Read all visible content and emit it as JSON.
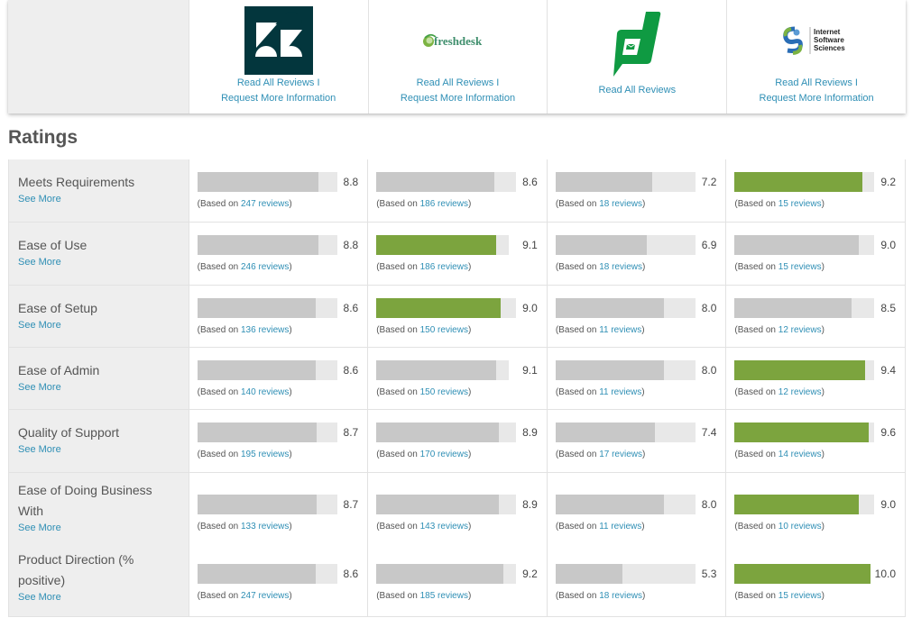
{
  "vendors": [
    {
      "name": "Zendesk",
      "logo_icon": "zendesk-logo",
      "read_all_reviews": "Read All Reviews",
      "separator": "I",
      "request_info": "Request More Information",
      "brand_color": "#03363d"
    },
    {
      "name": "Freshdesk",
      "logo_icon": "freshdesk-logo",
      "logo_text": "freshdesk",
      "read_all_reviews": "Read All Reviews",
      "separator": "I",
      "request_info": "Request More Information",
      "brand_color": "#2e8b57"
    },
    {
      "name": "Zoho Desk",
      "logo_icon": "zoho-desk-logo",
      "read_all_reviews": "Read All Reviews",
      "brand_color": "#0f9a42"
    },
    {
      "name": "Internet Software Sciences",
      "logo_icon": "internet-software-sciences-logo",
      "logo_text_lines": [
        "Internet",
        "Software",
        "Sciences"
      ],
      "read_all_reviews": "Read All Reviews",
      "separator": "I",
      "request_info": "Request More Information",
      "brand_color": "#2a6db5"
    }
  ],
  "ratings": {
    "title": "Ratings",
    "see_more_label": "See More",
    "based_on_prefix": "(Based on",
    "based_on_suffix": ")",
    "reviews_word": "reviews",
    "best_color": "#7ca43e",
    "bar_color": "#c8c8c8",
    "track_color": "#e8e8e8",
    "max_score": 10,
    "rows": [
      {
        "label": "Meets Requirements",
        "cells": [
          {
            "score": "8.8",
            "reviews": "247",
            "best": false
          },
          {
            "score": "8.6",
            "reviews": "186",
            "best": false
          },
          {
            "score": "7.2",
            "reviews": "18",
            "best": false
          },
          {
            "score": "9.2",
            "reviews": "15",
            "best": true
          }
        ]
      },
      {
        "label": "Ease of Use",
        "cells": [
          {
            "score": "8.8",
            "reviews": "246",
            "best": false
          },
          {
            "score": "9.1",
            "reviews": "186",
            "best": true
          },
          {
            "score": "6.9",
            "reviews": "18",
            "best": false
          },
          {
            "score": "9.0",
            "reviews": "15",
            "best": false
          }
        ]
      },
      {
        "label": "Ease of Setup",
        "cells": [
          {
            "score": "8.6",
            "reviews": "136",
            "best": false
          },
          {
            "score": "9.0",
            "reviews": "150",
            "best": true
          },
          {
            "score": "8.0",
            "reviews": "11",
            "best": false
          },
          {
            "score": "8.5",
            "reviews": "12",
            "best": false
          }
        ]
      },
      {
        "label": "Ease of Admin",
        "cells": [
          {
            "score": "8.6",
            "reviews": "140",
            "best": false
          },
          {
            "score": "9.1",
            "reviews": "150",
            "best": false
          },
          {
            "score": "8.0",
            "reviews": "11",
            "best": false
          },
          {
            "score": "9.4",
            "reviews": "12",
            "best": true
          }
        ]
      },
      {
        "label": "Quality of Support",
        "cells": [
          {
            "score": "8.7",
            "reviews": "195",
            "best": false
          },
          {
            "score": "8.9",
            "reviews": "170",
            "best": false
          },
          {
            "score": "7.4",
            "reviews": "17",
            "best": false
          },
          {
            "score": "9.6",
            "reviews": "14",
            "best": true
          }
        ]
      },
      {
        "label": "Ease of Doing Business With",
        "cells": [
          {
            "score": "8.7",
            "reviews": "133",
            "best": false
          },
          {
            "score": "8.9",
            "reviews": "143",
            "best": false
          },
          {
            "score": "8.0",
            "reviews": "11",
            "best": false
          },
          {
            "score": "9.0",
            "reviews": "10",
            "best": true
          }
        ]
      },
      {
        "label": "Product Direction (% positive)",
        "cells": [
          {
            "score": "8.6",
            "reviews": "247",
            "best": false
          },
          {
            "score": "9.2",
            "reviews": "185",
            "best": false
          },
          {
            "score": "5.3",
            "reviews": "18",
            "best": false
          },
          {
            "score": "10.0",
            "reviews": "15",
            "best": true
          }
        ]
      }
    ]
  }
}
